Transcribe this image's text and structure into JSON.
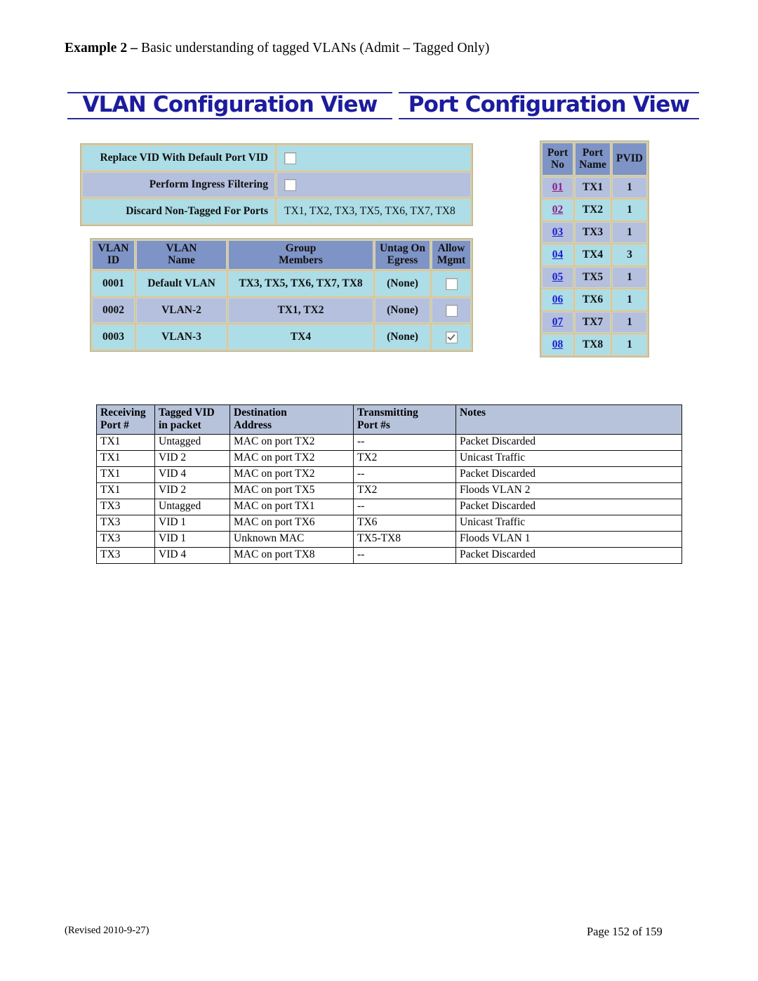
{
  "page": {
    "heading_lead": "Example 2 – ",
    "heading_rest": "Basic understanding of tagged VLANs (Admit – Tagged Only)",
    "footer_left": "(Revised 2010-9-27)",
    "footer_right": "Page 152 of  159"
  },
  "colors": {
    "title_blue": "#1c1c9e",
    "row_cyan": "#addde6",
    "row_blue": "#b4c0de",
    "header_slate": "#7e93c6",
    "table_header_light": "#b7c3da",
    "link_blue": "#1b1bd2",
    "link_visited": "#8b1a8b"
  },
  "vlan_view": {
    "title": "VLAN Configuration View",
    "settings": [
      {
        "label": "Replace VID With Default Port VID",
        "type": "checkbox",
        "checked": false,
        "value": ""
      },
      {
        "label": "Perform Ingress Filtering",
        "type": "checkbox",
        "checked": false,
        "value": ""
      },
      {
        "label": "Discard Non-Tagged For Ports",
        "type": "text",
        "value": "TX1, TX2, TX3, TX5, TX6, TX7, TX8"
      }
    ],
    "table": {
      "headers": [
        {
          "line1": "VLAN",
          "line2": "ID"
        },
        {
          "line1": "VLAN",
          "line2": "Name"
        },
        {
          "line1": "Group",
          "line2": "Members"
        },
        {
          "line1": "Untag On",
          "line2": "Egress"
        },
        {
          "line1": "Allow",
          "line2": "Mgmt"
        }
      ],
      "rows": [
        {
          "vlan_id": "0001",
          "vlan_name": "Default VLAN",
          "group_members": "TX3, TX5, TX6, TX7, TX8",
          "untag_on_egress": "(None)",
          "allow_mgmt": false
        },
        {
          "vlan_id": "0002",
          "vlan_name": "VLAN-2",
          "group_members": "TX1, TX2",
          "untag_on_egress": "(None)",
          "allow_mgmt": false
        },
        {
          "vlan_id": "0003",
          "vlan_name": "VLAN-3",
          "group_members": "TX4",
          "untag_on_egress": "(None)",
          "allow_mgmt": true
        }
      ]
    }
  },
  "port_view": {
    "title": "Port Configuration View",
    "table": {
      "headers": [
        {
          "line1": "Port",
          "line2": "No"
        },
        {
          "line1": "Port",
          "line2": "Name"
        },
        {
          "line1": "PVID",
          "line2": ""
        }
      ],
      "rows": [
        {
          "port_no": "01",
          "port_name": "TX1",
          "pvid": "1",
          "visited": true
        },
        {
          "port_no": "02",
          "port_name": "TX2",
          "pvid": "1",
          "visited": true
        },
        {
          "port_no": "03",
          "port_name": "TX3",
          "pvid": "1",
          "visited": false
        },
        {
          "port_no": "04",
          "port_name": "TX4",
          "pvid": "3",
          "visited": false
        },
        {
          "port_no": "05",
          "port_name": "TX5",
          "pvid": "1",
          "visited": false
        },
        {
          "port_no": "06",
          "port_name": "TX6",
          "pvid": "1",
          "visited": false
        },
        {
          "port_no": "07",
          "port_name": "TX7",
          "pvid": "1",
          "visited": false
        },
        {
          "port_no": "08",
          "port_name": "TX8",
          "pvid": "1",
          "visited": false
        }
      ]
    }
  },
  "traffic_table": {
    "headers": [
      {
        "line1": "Receiving",
        "line2": "Port #"
      },
      {
        "line1": "Tagged VID",
        "line2": "in packet"
      },
      {
        "line1": "Destination",
        "line2": "Address"
      },
      {
        "line1": "Transmitting",
        "line2": "Port #s"
      },
      {
        "line1": "Notes",
        "line2": ""
      }
    ],
    "rows": [
      {
        "receiving_port": "TX1",
        "tagged_vid": "Untagged",
        "destination": "MAC on port TX2",
        "transmitting": "--",
        "notes": "Packet Discarded"
      },
      {
        "receiving_port": "TX1",
        "tagged_vid": "VID 2",
        "destination": "MAC on port TX2",
        "transmitting": "TX2",
        "notes": "Unicast Traffic"
      },
      {
        "receiving_port": "TX1",
        "tagged_vid": "VID 4",
        "destination": "MAC on port TX2",
        "transmitting": "--",
        "notes": "Packet Discarded"
      },
      {
        "receiving_port": "TX1",
        "tagged_vid": "VID 2",
        "destination": "MAC on port TX5",
        "transmitting": "TX2",
        "notes": "Floods VLAN 2"
      },
      {
        "receiving_port": "TX3",
        "tagged_vid": "Untagged",
        "destination": "MAC on port TX1",
        "transmitting": "--",
        "notes": "Packet Discarded"
      },
      {
        "receiving_port": "TX3",
        "tagged_vid": "VID 1",
        "destination": "MAC on port TX6",
        "transmitting": "TX6",
        "notes": "Unicast Traffic"
      },
      {
        "receiving_port": "TX3",
        "tagged_vid": "VID 1",
        "destination": "Unknown MAC",
        "transmitting": "TX5-TX8",
        "notes": "Floods VLAN 1"
      },
      {
        "receiving_port": "TX3",
        "tagged_vid": "VID 4",
        "destination": "MAC on port TX8",
        "transmitting": "--",
        "notes": "Packet Discarded"
      }
    ]
  }
}
